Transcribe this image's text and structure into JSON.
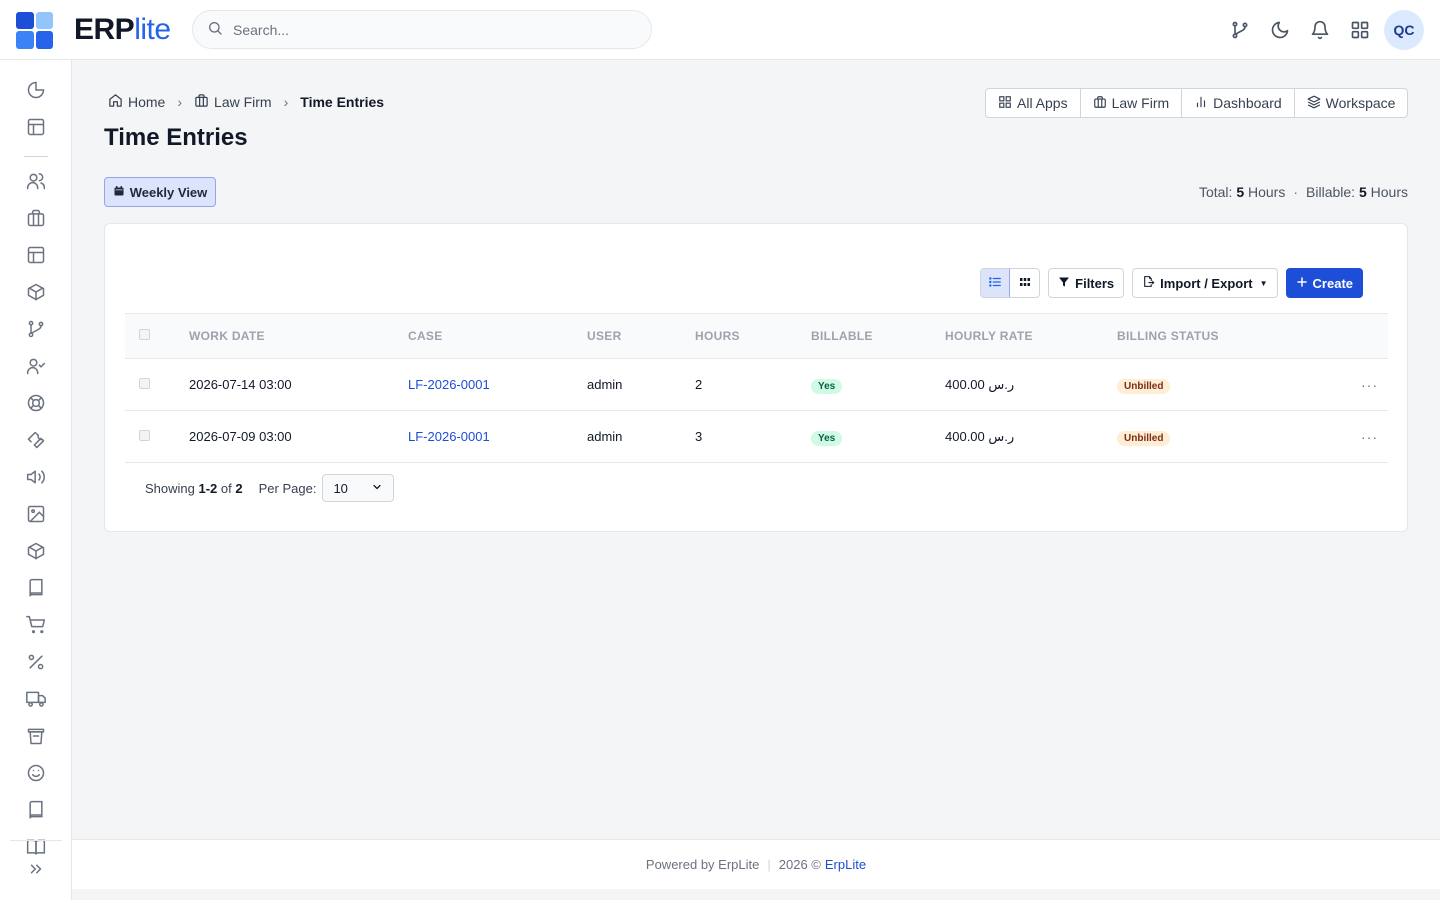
{
  "app": {
    "brand_bold": "ERP",
    "brand_light": "lite",
    "logo_colors": [
      "#1d4ed8",
      "#93c5fd",
      "#3b82f6",
      "#2563eb"
    ],
    "accent": "#1d4ed8"
  },
  "search": {
    "placeholder": "Search..."
  },
  "user": {
    "initials": "QC"
  },
  "breadcrumb": {
    "home": "Home",
    "parent": "Law Firm",
    "current": "Time Entries"
  },
  "page": {
    "title": "Time Entries"
  },
  "app_nav": [
    "All Apps",
    "Law Firm",
    "Dashboard",
    "Workspace"
  ],
  "weekly_view": "Weekly View",
  "totals": {
    "total_label": "Total:",
    "total_value": "5",
    "total_unit": "Hours",
    "billable_label": "Billable:",
    "billable_value": "5",
    "billable_unit": "Hours"
  },
  "toolbar": {
    "filters": "Filters",
    "import_export": "Import / Export",
    "create": "Create"
  },
  "table": {
    "columns": [
      "WORK DATE",
      "CASE",
      "USER",
      "HOURS",
      "BILLABLE",
      "HOURLY RATE",
      "BILLING STATUS"
    ],
    "rows": [
      {
        "work_date": "2026-07-14 03:00",
        "case": "LF-2026-0001",
        "user": "admin",
        "hours": "2",
        "billable": "Yes",
        "hourly_rate": "400.00 ر.س",
        "billing_status": "Unbilled"
      },
      {
        "work_date": "2026-07-09 03:00",
        "case": "LF-2026-0001",
        "user": "admin",
        "hours": "3",
        "billable": "Yes",
        "hourly_rate": "400.00 ر.س",
        "billing_status": "Unbilled"
      }
    ]
  },
  "pager": {
    "showing": "Showing",
    "range": "1-2",
    "of": "of",
    "total": "2",
    "per_page_label": "Per Page:",
    "per_page_value": "10"
  },
  "footer": {
    "powered": "Powered by ErpLite",
    "year": "2026 ©",
    "brand": "ErpLite"
  }
}
